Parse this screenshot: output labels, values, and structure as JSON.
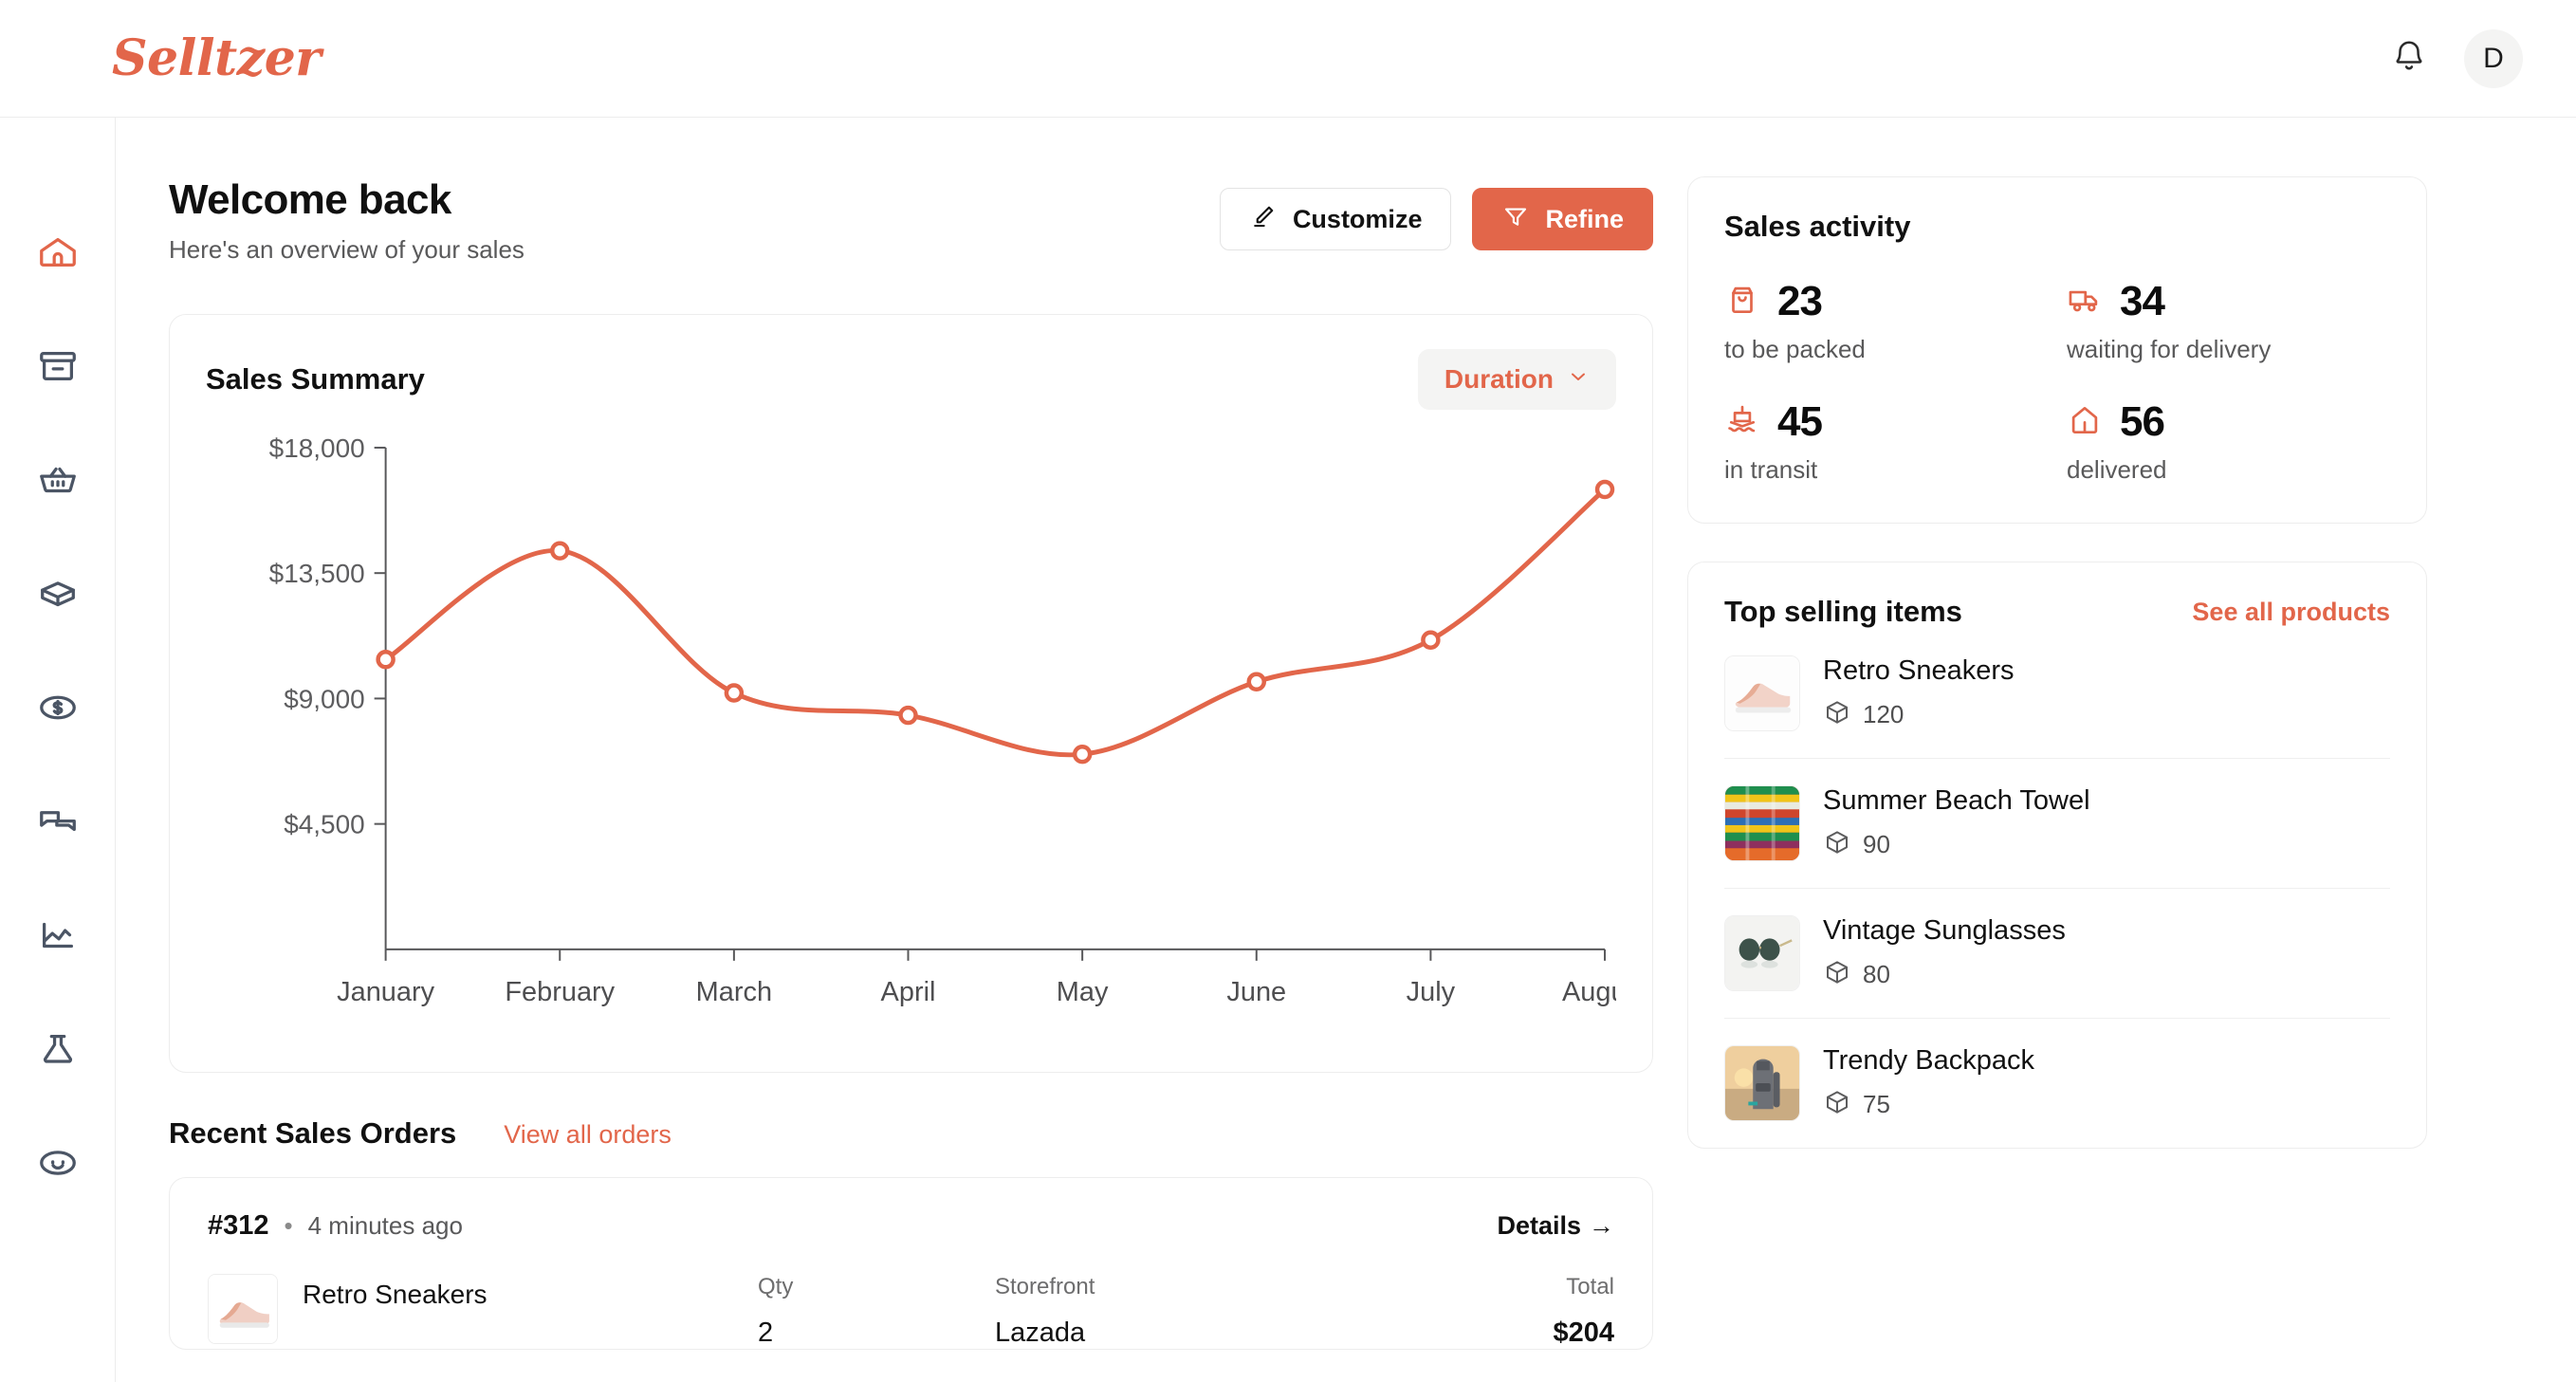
{
  "brand": {
    "name": "Selltzer",
    "accent": "#e2664a"
  },
  "header": {
    "notifications_icon": "bell-icon",
    "avatar_initial": "D"
  },
  "sidebar": {
    "items": [
      {
        "icon": "home-icon",
        "name": "home",
        "active": true
      },
      {
        "icon": "archive-box-icon",
        "name": "inventory",
        "active": false
      },
      {
        "icon": "basket-icon",
        "name": "orders",
        "active": false
      },
      {
        "icon": "package-icon",
        "name": "products",
        "active": false
      },
      {
        "icon": "dollar-coin-icon",
        "name": "finance",
        "active": false
      },
      {
        "icon": "chat-bubbles-icon",
        "name": "messages",
        "active": false
      },
      {
        "icon": "chart-line-icon",
        "name": "analytics",
        "active": false
      },
      {
        "icon": "flask-icon",
        "name": "experiments",
        "active": false
      },
      {
        "icon": "smiley-icon",
        "name": "support",
        "active": false
      }
    ]
  },
  "page": {
    "title": "Welcome back",
    "subtitle": "Here's an overview of your sales",
    "customize_label": "Customize",
    "refine_label": "Refine"
  },
  "sales_summary": {
    "title": "Sales Summary",
    "duration_label": "Duration"
  },
  "chart_data": {
    "type": "line",
    "title": "Sales Summary",
    "xlabel": "",
    "ylabel": "",
    "categories": [
      "January",
      "February",
      "March",
      "April",
      "May",
      "June",
      "July",
      "August"
    ],
    "values": [
      10400,
      14300,
      9200,
      8400,
      7000,
      9600,
      11100,
      16500
    ],
    "ytick_labels": [
      "$18,000",
      "$13,500",
      "$9,000",
      "$4,500"
    ],
    "yticks": [
      18000,
      13500,
      9000,
      4500
    ],
    "ylim": [
      0,
      18000
    ],
    "grid": false,
    "legend": "none",
    "line_color": "#e2664a",
    "marker": "open-circle"
  },
  "recent_orders": {
    "title": "Recent Sales Orders",
    "view_all_label": "View all orders",
    "orders": [
      {
        "id": "#312",
        "separator": "•",
        "time": "4 minutes ago",
        "details_label": "Details",
        "details_arrow": "→",
        "columns": {
          "product": "",
          "qty": "Qty",
          "storefront": "Storefront",
          "total": "Total"
        },
        "product_name": "Retro Sneakers",
        "qty": "2",
        "storefront": "Lazada",
        "total": "$204"
      }
    ]
  },
  "sales_activity": {
    "title": "Sales activity",
    "stats": [
      {
        "icon": "shopping-bag-icon",
        "value": "23",
        "label": "to be packed"
      },
      {
        "icon": "truck-icon",
        "value": "34",
        "label": "waiting for delivery"
      },
      {
        "icon": "ship-icon",
        "value": "45",
        "label": "in transit"
      },
      {
        "icon": "house-icon",
        "value": "56",
        "label": "delivered"
      }
    ]
  },
  "top_selling": {
    "title": "Top selling items",
    "see_all_label": "See all products",
    "items": [
      {
        "name": "Retro Sneakers",
        "stock": "120",
        "thumb": "sneaker"
      },
      {
        "name": "Summer Beach Towel",
        "stock": "90",
        "thumb": "towel"
      },
      {
        "name": "Vintage Sunglasses",
        "stock": "80",
        "thumb": "sunglasses"
      },
      {
        "name": "Trendy Backpack",
        "stock": "75",
        "thumb": "backpack"
      }
    ]
  }
}
